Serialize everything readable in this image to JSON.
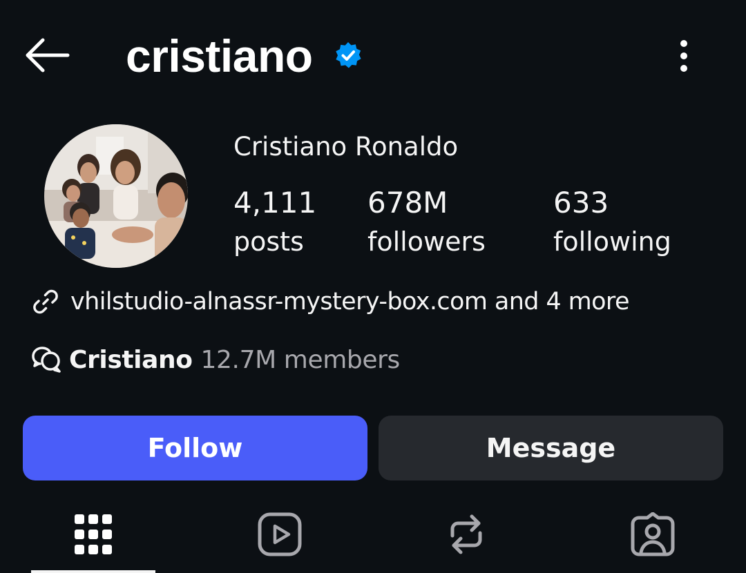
{
  "header": {
    "username": "cristiano",
    "verified": true,
    "icons": {
      "back": "back-arrow-icon",
      "verified": "verified-badge-icon",
      "more": "more-vertical-icon"
    }
  },
  "profile": {
    "full_name": "Cristiano Ronaldo",
    "avatar": "profile-photo",
    "stats": [
      {
        "value": "4,111",
        "label": "posts"
      },
      {
        "value": "678M",
        "label": "followers"
      },
      {
        "value": "633",
        "label": "following"
      }
    ],
    "link": {
      "icon": "link-icon",
      "text": "vhilstudio-alnassr-mystery-box.com and 4 more"
    },
    "channel": {
      "icon": "broadcast-channel-icon",
      "name": "Cristiano",
      "members": "12.7M members"
    }
  },
  "actions": {
    "follow_label": "Follow",
    "message_label": "Message"
  },
  "tabs": [
    {
      "icon": "grid-icon",
      "active": true
    },
    {
      "icon": "reels-icon",
      "active": false
    },
    {
      "icon": "reposts-icon",
      "active": false
    },
    {
      "icon": "tagged-icon",
      "active": false
    }
  ],
  "colors": {
    "background": "#0c1014",
    "primary_button": "#4a5df9",
    "secondary_button": "#26292e",
    "verified": "#0095f6",
    "muted_text": "#a8a8ad"
  }
}
